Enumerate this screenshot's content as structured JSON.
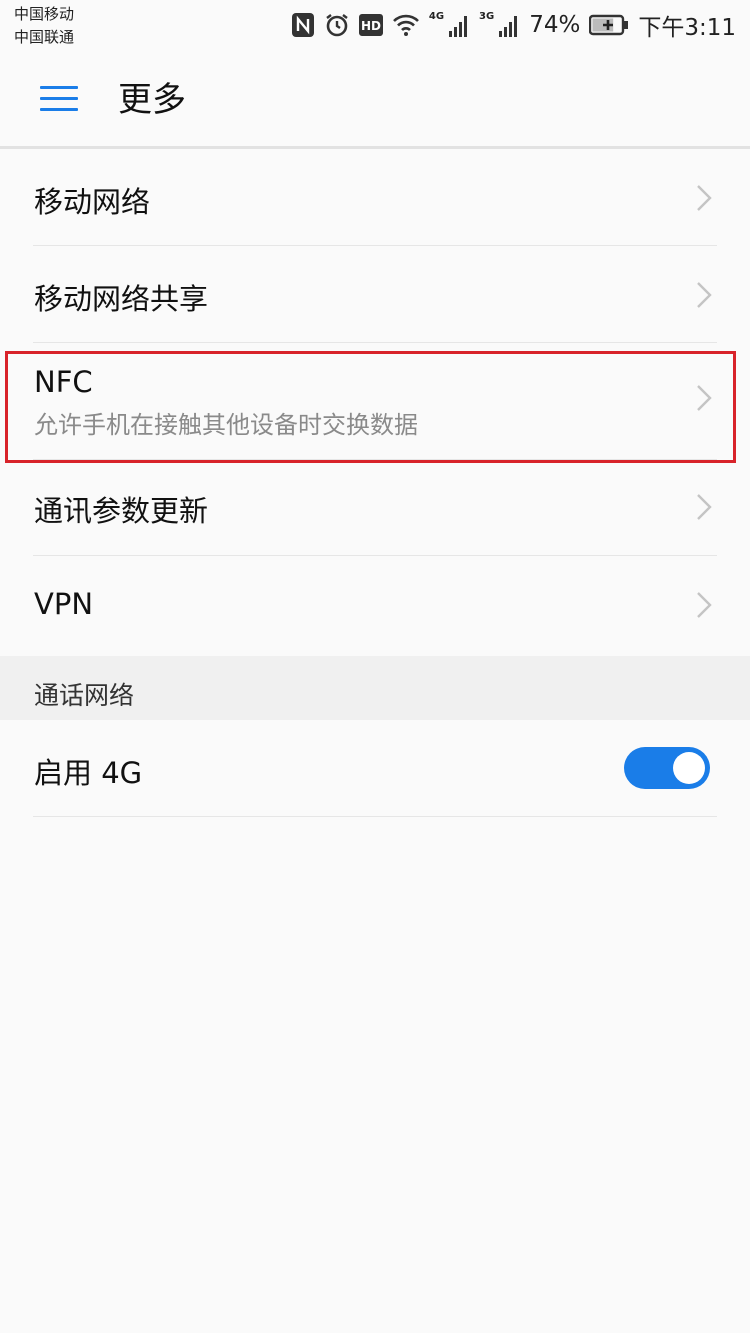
{
  "status_bar": {
    "carrier_1": "中国移动",
    "carrier_2": "中国联通",
    "icons": [
      "nfc-icon",
      "alarm-icon",
      "hd-icon",
      "wifi-icon",
      "signal-4g-icon",
      "signal-3g-icon",
      "battery-icon"
    ],
    "net_1": "4G",
    "net_2": "3G",
    "battery_percent": "74%",
    "battery_level": 0.74,
    "time": "下午3:11"
  },
  "appbar": {
    "menu_icon": "hamburger-menu-icon",
    "title": "更多"
  },
  "list": {
    "items": [
      {
        "title": "移动网络"
      },
      {
        "title": "移动网络共享"
      },
      {
        "title": "NFC",
        "subtitle": "允许手机在接触其他设备时交换数据"
      },
      {
        "title": "通讯参数更新"
      },
      {
        "title": "VPN"
      }
    ]
  },
  "section": {
    "label": "通话网络"
  },
  "enable_4g": {
    "label": "启用 4G",
    "enabled": true
  },
  "colors": {
    "accent": "#1a7de8",
    "highlight": "#d8232a",
    "background": "#fafafa"
  }
}
